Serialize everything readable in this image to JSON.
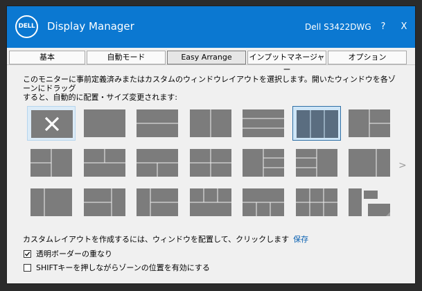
{
  "window": {
    "logo_text": "DELL",
    "title": "Display Manager",
    "monitor": "Dell S3422DWG",
    "help_label": "?",
    "close_label": "X"
  },
  "tabs": [
    {
      "label": "基本",
      "active": false
    },
    {
      "label": "自動モード",
      "active": false
    },
    {
      "label": "Easy Arrange",
      "active": true
    },
    {
      "label": "インプットマネージャー",
      "active": false
    },
    {
      "label": "オプション",
      "active": false
    }
  ],
  "description_line1": "このモニターに事前定義済みまたはカスタムのウィンドウレイアウトを選択します。開いたウィンドウを各ゾーンにドラッグ",
  "description_line2": "すると、自動的に配置・サイズ変更されます:",
  "next_page": ">",
  "custom_layout": {
    "text": "カスタムレイアウトを作成するには、ウィンドウを配置して、クリックします",
    "save_label": "保存"
  },
  "options": [
    {
      "label": "透明ボーダーの重なり",
      "checked": true
    },
    {
      "label": "SHIFTキーを押しながらゾーンの位置を有効にする",
      "checked": false
    }
  ],
  "layouts": {
    "selected_index": 5,
    "hovered_index": 0,
    "colors": {
      "zone": "#7c7c7c",
      "selected_zone": "#5a6d80",
      "zone_gap": "#f0f0f0"
    }
  }
}
